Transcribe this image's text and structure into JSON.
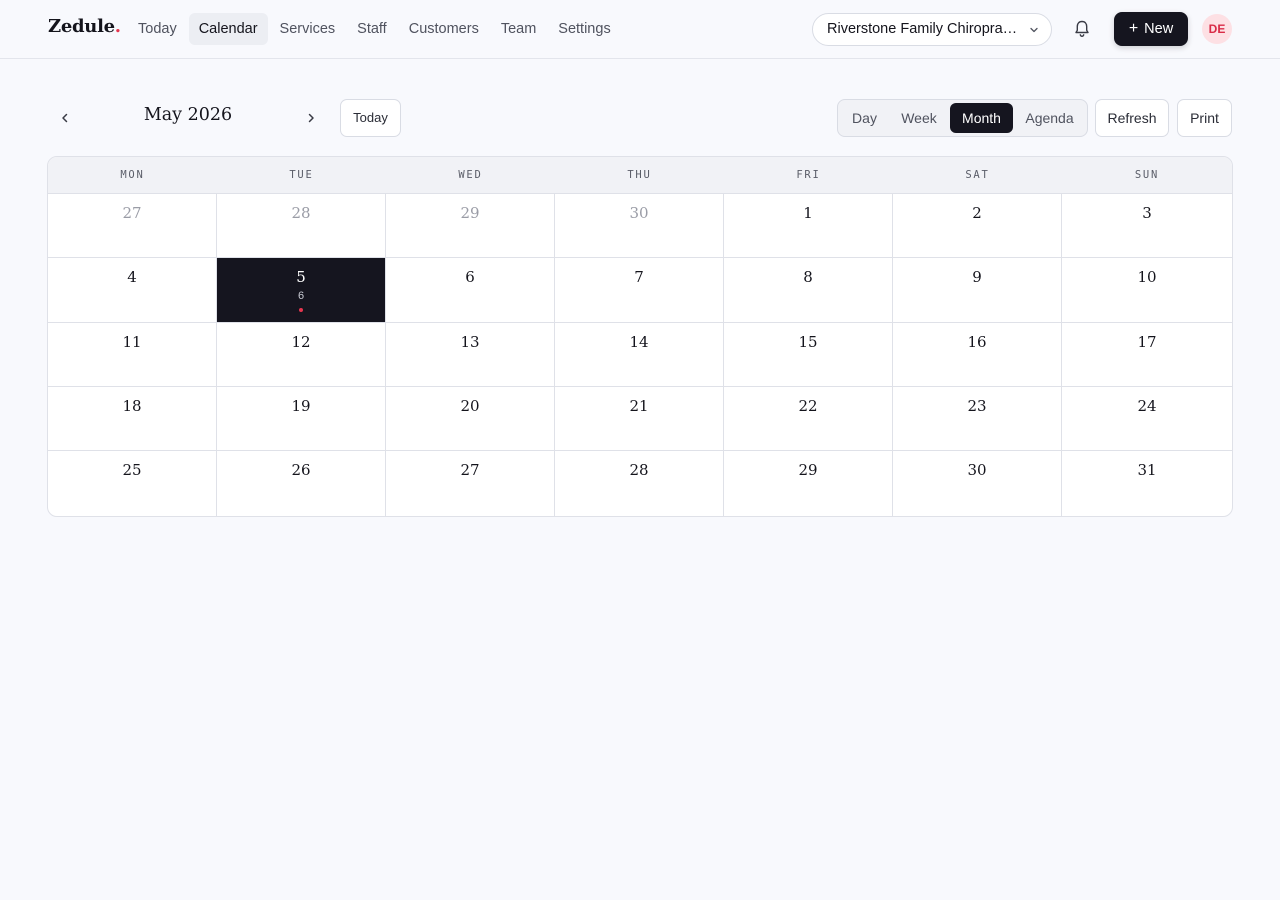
{
  "app": {
    "logo_text": "Zedule",
    "logo_dot": ".",
    "accent": "#e5364f",
    "dark": "#15151f"
  },
  "nav": {
    "items": [
      {
        "label": "Today",
        "active": false
      },
      {
        "label": "Calendar",
        "active": true
      },
      {
        "label": "Services",
        "active": false
      },
      {
        "label": "Staff",
        "active": false
      },
      {
        "label": "Customers",
        "active": false
      },
      {
        "label": "Team",
        "active": false
      },
      {
        "label": "Settings",
        "active": false
      }
    ]
  },
  "header": {
    "location": "Riverstone Family Chiropractic",
    "location_icon": "chevron-down-icon",
    "notification_icon": "bell-icon",
    "new_label": "New",
    "new_icon": "plus-icon",
    "avatar_initials": "DE"
  },
  "toolbar": {
    "prev_icon": "chevron-left-icon",
    "next_icon": "chevron-right-icon",
    "month_title": "May 2026",
    "today_label": "Today",
    "views": [
      {
        "label": "Day",
        "active": false
      },
      {
        "label": "Week",
        "active": false
      },
      {
        "label": "Month",
        "active": true
      },
      {
        "label": "Agenda",
        "active": false
      }
    ],
    "refresh_label": "Refresh",
    "print_label": "Print"
  },
  "calendar": {
    "weekdays": [
      "MON",
      "TUE",
      "WED",
      "THU",
      "FRI",
      "SAT",
      "SUN"
    ],
    "weeks": [
      [
        {
          "day": "27",
          "muted": true
        },
        {
          "day": "28",
          "muted": true
        },
        {
          "day": "29",
          "muted": true
        },
        {
          "day": "30",
          "muted": true
        },
        {
          "day": "1"
        },
        {
          "day": "2"
        },
        {
          "day": "3"
        }
      ],
      [
        {
          "day": "4"
        },
        {
          "day": "5",
          "today": true,
          "count": "6",
          "has_event": true
        },
        {
          "day": "6"
        },
        {
          "day": "7"
        },
        {
          "day": "8"
        },
        {
          "day": "9"
        },
        {
          "day": "10"
        }
      ],
      [
        {
          "day": "11"
        },
        {
          "day": "12"
        },
        {
          "day": "13"
        },
        {
          "day": "14"
        },
        {
          "day": "15"
        },
        {
          "day": "16"
        },
        {
          "day": "17"
        }
      ],
      [
        {
          "day": "18"
        },
        {
          "day": "19"
        },
        {
          "day": "20"
        },
        {
          "day": "21"
        },
        {
          "day": "22"
        },
        {
          "day": "23"
        },
        {
          "day": "24"
        }
      ],
      [
        {
          "day": "25"
        },
        {
          "day": "26"
        },
        {
          "day": "27"
        },
        {
          "day": "28"
        },
        {
          "day": "29"
        },
        {
          "day": "30"
        },
        {
          "day": "31"
        }
      ]
    ]
  }
}
